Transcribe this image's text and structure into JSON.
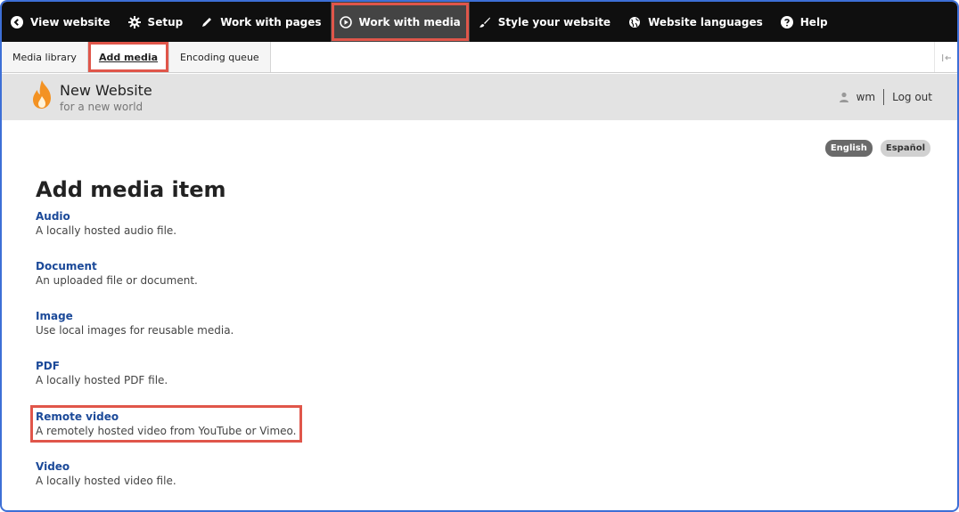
{
  "toolbar": {
    "items": [
      {
        "label": "View website",
        "icon": "back-arrow-icon"
      },
      {
        "label": "Setup",
        "icon": "gear-icon"
      },
      {
        "label": "Work with pages",
        "icon": "pencil-icon"
      },
      {
        "label": "Work with media",
        "icon": "play-circle-icon"
      },
      {
        "label": "Style your website",
        "icon": "paintbrush-icon"
      },
      {
        "label": "Website languages",
        "icon": "globe-icon"
      },
      {
        "label": "Help",
        "icon": "question-icon"
      }
    ]
  },
  "subtabs": [
    {
      "label": "Media library"
    },
    {
      "label": "Add media"
    },
    {
      "label": "Encoding queue"
    }
  ],
  "site": {
    "name": "New Website",
    "slogan": "for a new world"
  },
  "user": {
    "name": "wm",
    "logout": "Log out"
  },
  "languages": [
    "English",
    "Español"
  ],
  "page": {
    "title": "Add media item",
    "items": [
      {
        "label": "Audio",
        "description": "A locally hosted audio file."
      },
      {
        "label": "Document",
        "description": "An uploaded file or document."
      },
      {
        "label": "Image",
        "description": "Use local images for reusable media."
      },
      {
        "label": "PDF",
        "description": "A locally hosted PDF file."
      },
      {
        "label": "Remote video",
        "description": "A remotely hosted video from YouTube or Vimeo."
      },
      {
        "label": "Video",
        "description": "A locally hosted video file."
      }
    ]
  },
  "colors": {
    "toolbar_bg": "#0f0f0f",
    "highlight": "#e0564a",
    "link": "#1c4a99",
    "header_bg": "#e3e3e3"
  }
}
